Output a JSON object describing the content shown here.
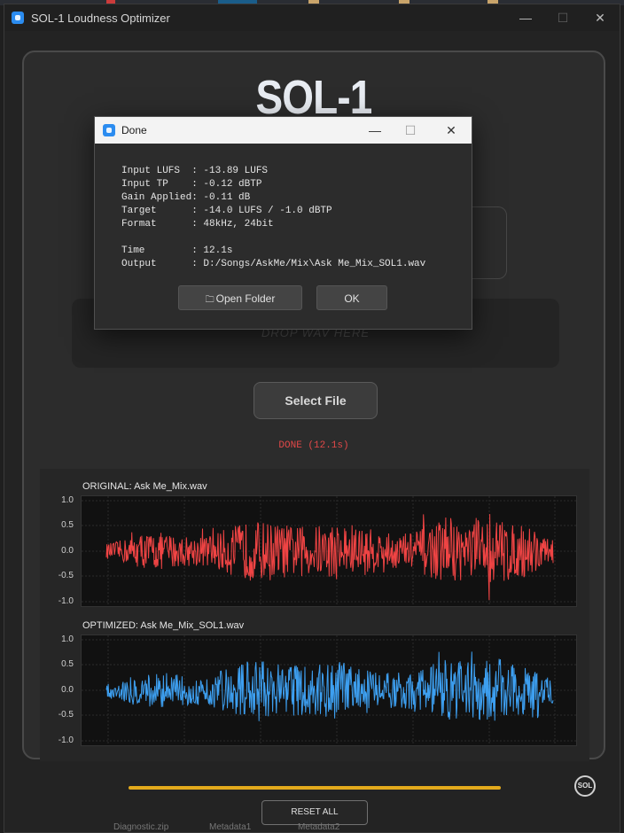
{
  "window": {
    "title": "SOL-1 Loudness Optimizer",
    "minimize": "—",
    "maximize": "☐",
    "close": "✕"
  },
  "app": {
    "logo_text": "SOL-1",
    "drop_zone_text": "DROP WAV HERE",
    "select_file_label": "Select File",
    "status_text": "DONE  (12.1s)",
    "reset_label": "RESET ALL",
    "badge_text": "SOL",
    "progress_fraction": 1.0
  },
  "waveforms": {
    "original_title": "ORIGINAL: Ask Me_Mix.wav",
    "optimized_title": "OPTIMIZED: Ask Me_Mix_SOL1.wav",
    "y_ticks": [
      "1.0",
      "0.5",
      "0.0",
      "-0.5",
      "-1.0"
    ],
    "original_color": "#f04444",
    "optimized_color": "#3d9ff0"
  },
  "dialog": {
    "title": "Done",
    "maximize": "☐",
    "minimize": "—",
    "close": "✕",
    "report_lines": [
      "Input LUFS  : -13.89 LUFS",
      "Input TP    : -0.12 dBTP",
      "Gain Applied: -0.11 dB",
      "Target      : -14.0 LUFS / -1.0 dBTP",
      "Format      : 48kHz, 24bit",
      "",
      "Time        : 12.1s",
      "Output      : D:/Songs/AskMe/Mix\\Ask Me_Mix_SOL1.wav"
    ],
    "open_folder_label": "Open Folder",
    "ok_label": "OK",
    "folder_icon": "folder-icon"
  },
  "background": {
    "taskbar_items": [
      "Diagnostic.zip",
      "Metadata1",
      "Metadata2"
    ]
  }
}
